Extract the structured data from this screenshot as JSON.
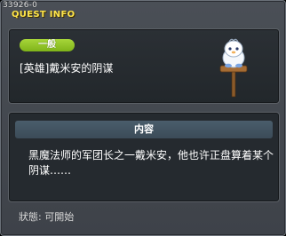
{
  "window": {
    "quest_id": "33926-0",
    "title": "QUEST INFO"
  },
  "quest": {
    "category_badge": "一般",
    "name": "[英雄]戴米安的阴谋",
    "npc_icon": "snowman-signpost-icon"
  },
  "content": {
    "header": "内容",
    "description": "黑魔法师的军团长之一戴米安，他也许正盘算着某个阴谋……"
  },
  "status": {
    "label": "狀態:",
    "value": "可開始"
  },
  "colors": {
    "title": "#ffe64a",
    "badge": "#8cc424",
    "section_header": "#44566a"
  }
}
